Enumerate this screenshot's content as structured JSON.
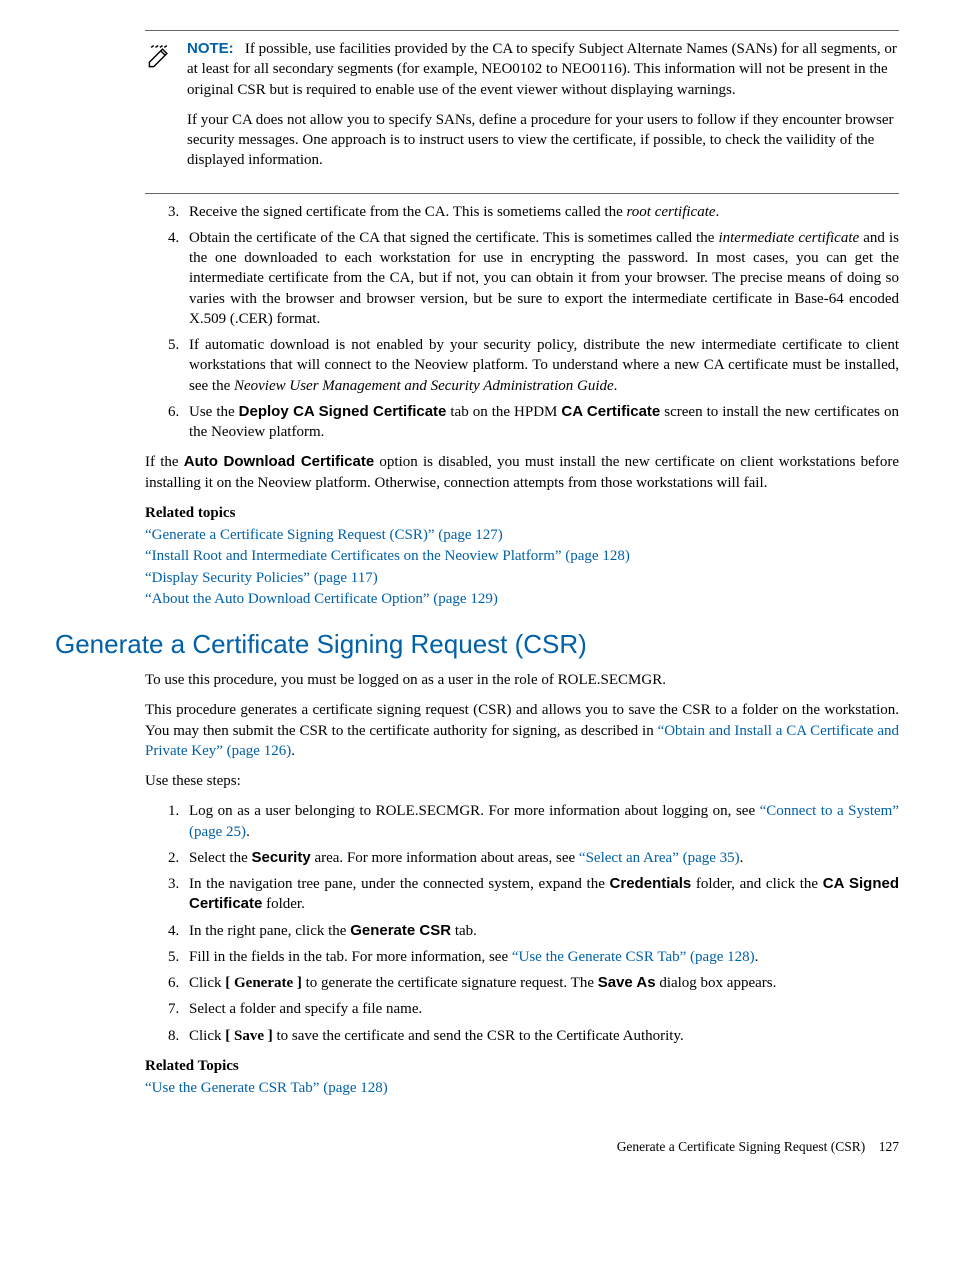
{
  "note": {
    "label": "NOTE:",
    "para1_a": "If possible, use facilities provided by the CA to specify Subject Alternate Names (SANs) for all segments, or at least for all secondary segments (for example, NEO0102 to NEO0116). This information will not be present in the original CSR but is required to enable use of the event viewer without displaying warnings.",
    "para2": "If your CA does not allow you to specify SANs, define a procedure for your users to follow if they encounter browser security messages. One approach is to instruct users to view the certificate, if possible, to check the vailidity of the displayed information."
  },
  "list1": {
    "i3_a": "Receive the signed certificate from the CA. This is sometiems called the ",
    "i3_b": "root certificate",
    "i3_c": ".",
    "i4_a": "Obtain the certificate of the CA that signed the certificate. This is sometimes called the ",
    "i4_b": "intermediate certificate",
    "i4_c": " and is the one downloaded to each workstation for use in encrypting the password. In most cases, you can get the intermediate certificate from the CA, but if not, you can obtain it from your browser. The precise means of doing so varies with the browser and browser version, but be sure to export the intermediate certificate in Base-64 encoded X.509 (.CER) format.",
    "i5_a": "If automatic download is not enabled by your security policy, distribute the new intermediate certificate to client workstations that will connect to the Neoview platform. To understand where a new CA certificate must be installed, see the ",
    "i5_b": "Neoview User Management and Security Administration Guide",
    "i5_c": ".",
    "i6_a": "Use the ",
    "i6_b": "Deploy CA Signed Certificate",
    "i6_c": " tab on the HPDM ",
    "i6_d": "CA Certificate",
    "i6_e": " screen to install the new certificates on the Neoview platform."
  },
  "para_after_list_a": "If the ",
  "para_after_list_b": "Auto Download Certificate",
  "para_after_list_c": " option is disabled, you must install the new certificate on client workstations before installing it on the Neoview platform. Otherwise, connection attempts from those workstations will fail.",
  "related1": {
    "heading": "Related topics",
    "l1": "“Generate a Certificate Signing Request (CSR)” (page 127)",
    "l2": "“Install Root and Intermediate Certificates on the Neoview Platform” (page 128)",
    "l3": "“Display Security Policies” (page 117)",
    "l4": "“About the Auto Download Certificate Option” (page 129)"
  },
  "section": {
    "title": "Generate a Certificate Signing Request (CSR)",
    "p1": "To use this procedure, you must be logged on as a user in the role of ROLE.SECMGR.",
    "p2_a": "This procedure generates a certificate signing request (CSR) and allows you to save the CSR to a folder on the workstation. You may then submit the CSR to the certificate authority for signing, as described in ",
    "p2_link": "“Obtain and Install a CA Certificate and Private Key” (page 126)",
    "p2_b": ".",
    "p3": "Use these steps:"
  },
  "steps": {
    "s1_a": "Log on as a user belonging to ROLE.SECMGR. For more information about logging on, see ",
    "s1_link": "“Connect to a System” (page 25)",
    "s1_b": ".",
    "s2_a": "Select the ",
    "s2_bold": "Security",
    "s2_b": " area. For more information about areas, see ",
    "s2_link": "“Select an Area” (page 35)",
    "s2_c": ".",
    "s3_a": "In the navigation tree pane, under the connected system, expand the ",
    "s3_bold1": "Credentials",
    "s3_b": " folder, and click the ",
    "s3_bold2": "CA Signed Certificate",
    "s3_c": " folder.",
    "s4_a": "In the right pane, click the ",
    "s4_bold": "Generate CSR",
    "s4_b": " tab.",
    "s5_a": "Fill in the fields in the tab. For more information, see ",
    "s5_link": "“Use the Generate CSR Tab” (page 128)",
    "s5_b": ".",
    "s6_a": "Click ",
    "s6_bold1": "[ Generate ]",
    "s6_b": " to generate the certificate signature request. The ",
    "s6_bold2": "Save As",
    "s6_c": " dialog box appears.",
    "s7": "Select a folder and specify a file name.",
    "s8_a": "Click ",
    "s8_bold": "[ Save ]",
    "s8_b": " to save the certificate and send the CSR to the Certificate Authority."
  },
  "related2": {
    "heading": "Related Topics",
    "l1": "“Use the Generate CSR Tab” (page 128)"
  },
  "footer": "Generate a Certificate Signing Request (CSR) 127"
}
